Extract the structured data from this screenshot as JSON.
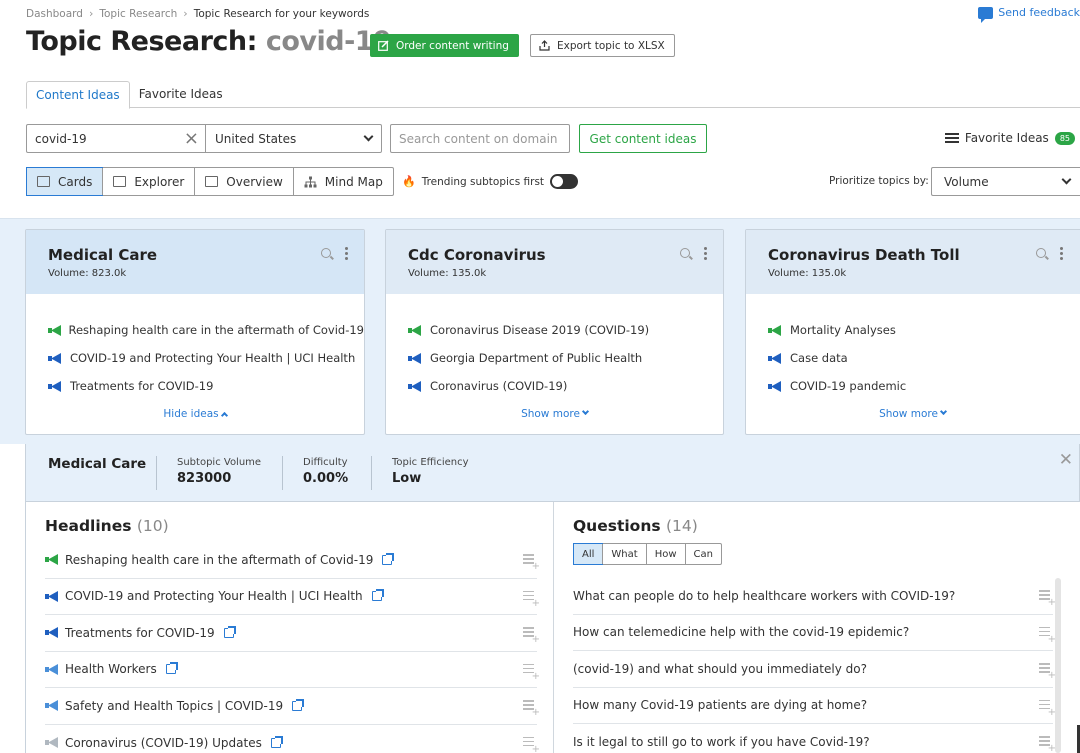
{
  "breadcrumb": [
    "Dashboard",
    "Topic Research",
    "Topic Research for your keywords"
  ],
  "feedback_label": "Send feedback",
  "title": {
    "prefix": "Topic Research:",
    "keyword": "covid-19"
  },
  "order_btn": "Order content writing",
  "export_btn": "Export topic to XLSX",
  "tabs": [
    "Content Ideas",
    "Favorite Ideas"
  ],
  "search": {
    "keyword_value": "covid-19",
    "country_value": "United States",
    "domain_placeholder": "Search content on domain",
    "get_ideas_label": "Get content ideas"
  },
  "favorite_ideas": {
    "label": "Favorite Ideas",
    "count": "85"
  },
  "views": [
    "Cards",
    "Explorer",
    "Overview",
    "Mind Map"
  ],
  "trending_label": "Trending subtopics first",
  "prioritize": {
    "label": "Prioritize topics by:",
    "value": "Volume"
  },
  "cards": [
    {
      "title": "Medical Care",
      "volume": "Volume:  823.0k",
      "items": [
        {
          "text": "Reshaping health care in the aftermath of Covid-19",
          "icon": "green"
        },
        {
          "text": "COVID-19 and Protecting Your Health | UCI Health",
          "icon": "blue"
        },
        {
          "text": "Treatments for COVID-19",
          "icon": "blue"
        }
      ],
      "footer": "Hide ideas"
    },
    {
      "title": "Cdc Coronavirus",
      "volume": "Volume:  135.0k",
      "items": [
        {
          "text": "Coronavirus Disease 2019 (COVID-19)",
          "icon": "green"
        },
        {
          "text": "Georgia Department of Public Health",
          "icon": "blue"
        },
        {
          "text": "Coronavirus (COVID-19)",
          "icon": "blue"
        }
      ],
      "footer": "Show more"
    },
    {
      "title": "Coronavirus Death Toll",
      "volume": "Volume:  135.0k",
      "items": [
        {
          "text": "Mortality Analyses",
          "icon": "green"
        },
        {
          "text": "Case data",
          "icon": "blue"
        },
        {
          "text": "COVID-19 pandemic",
          "icon": "blue"
        }
      ],
      "footer": "Show more"
    }
  ],
  "detail": {
    "title": "Medical Care",
    "subtopic_volume_label": "Subtopic Volume",
    "subtopic_volume": "823000",
    "difficulty_label": "Difficulty",
    "difficulty": "0.00%",
    "efficiency_label": "Topic Efficiency",
    "efficiency": "Low"
  },
  "headlines": {
    "title": "Headlines",
    "count": "(10)",
    "items": [
      {
        "text": "Reshaping health care in the aftermath of Covid-19",
        "icon": "green"
      },
      {
        "text": "COVID-19 and Protecting Your Health | UCI Health",
        "icon": "blue"
      },
      {
        "text": "Treatments for COVID-19",
        "icon": "blue"
      },
      {
        "text": "Health Workers",
        "icon": "lblue"
      },
      {
        "text": "Safety and Health Topics | COVID-19",
        "icon": "lblue"
      },
      {
        "text": "Coronavirus (COVID-19) Updates",
        "icon": "grey"
      }
    ]
  },
  "questions": {
    "title": "Questions",
    "count": "(14)",
    "filters": [
      "All",
      "What",
      "How",
      "Can"
    ],
    "items": [
      "What can people do to help healthcare workers with COVID-19?",
      "How can telemedicine help with the covid-19 epidemic?",
      "(covid-19) and what should you immediately do?",
      "How many Covid-19 patients are dying at home?",
      "Is it legal to still go to work if you have Covid-19?"
    ]
  }
}
